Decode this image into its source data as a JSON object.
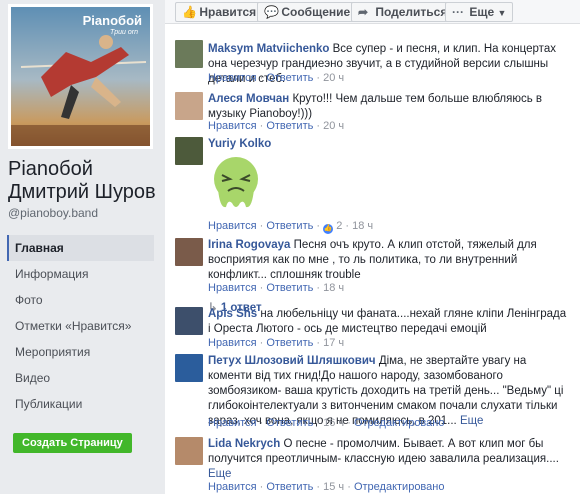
{
  "page": {
    "cover_brand": "Pianoбой",
    "cover_sub": "Tpuu orn",
    "name": "Pianoбой Дмитрий Шуров",
    "handle": "@pianoboy.band"
  },
  "nav": [
    "Главная",
    "Информация",
    "Фото",
    "Отметки «Нравится»",
    "Мероприятия",
    "Видео",
    "Публикации"
  ],
  "create_button": "Создать Страницу",
  "topbar": {
    "like": "Нравится",
    "message": "Сообщение",
    "share": "Поделиться",
    "more": "Еще"
  },
  "comments": [
    {
      "author": "Maksym Matviichenko",
      "text": "Все супер - и песня, и клип. На концертах она черезчур грандиеэно звучит, а в студийной версии слышны детали и стеб.",
      "like": "Нравится",
      "reply": "Ответить",
      "time": "20 ч"
    },
    {
      "author": "Алеся Мовчан",
      "text": "Круто!!! Чем дальше тем больше влюбляюсь в музыку Pianoboy!)))",
      "like": "Нравится",
      "reply": "Ответить",
      "time": "20 ч"
    },
    {
      "author": "Yuriy Kolko",
      "text": "",
      "like": "Нравится",
      "reply": "Ответить",
      "likes": "2",
      "time": "18 ч"
    },
    {
      "author": "Irina Rogovaya",
      "text": "Песня очъ круто. А клип отстой, тяжелый для восприятия как по мне , то ль политика, то ли внутренний конфликт... сплошняк trouble",
      "like": "Нравится",
      "reply": "Ответить",
      "time": "18 ч",
      "replies": "1 ответ"
    },
    {
      "author": "Apis Shs",
      "text": "на любельніцу чи фаната....нехай гляне кліпи Ленінграда і Ореста Лютого - ось де мистецтво передачі емоцій",
      "like": "Нравится",
      "reply": "Ответить",
      "time": "17 ч"
    },
    {
      "author": "Петух Шлозовий Шляшкович",
      "text": "Діма, не звертайте увагу на коменти від тих гнид!До нашого народу, зазомбованого зомбоязиком- ваша крутість доходить на третій день... \"Ведьму\" ці глибокоінтелектуали з витонченим смаком почали слухати тільки зараз, хоч вона, якщо я не помиляюсь, в 201...",
      "more": "Еще",
      "like": "Нравится",
      "reply": "Ответить",
      "time": "16 ч",
      "edited": "Отредактировано"
    },
    {
      "author": "Lida Nekrych",
      "text": "О песне - промолчим. Бывает. А вот клип мог бы получится преотличным- классную идею завалила реализация....",
      "more": "Еще",
      "like": "Нравится",
      "reply": "Ответить",
      "time": "15 ч",
      "edited": "Отредактировано"
    }
  ],
  "colors": {
    "link": "#365899",
    "meta": "#90949c",
    "accent": "#4267b2",
    "create": "#42b72a"
  }
}
